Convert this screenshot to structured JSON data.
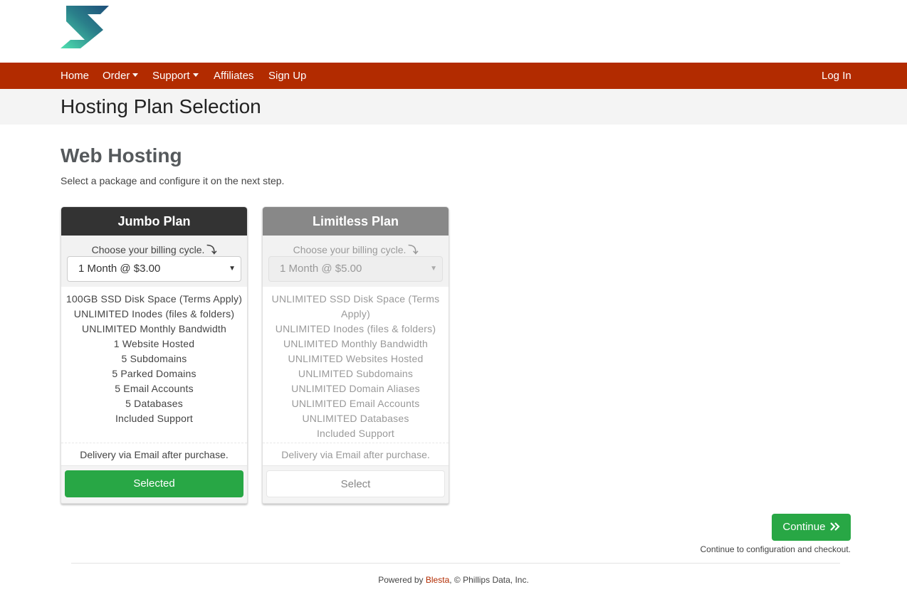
{
  "brand": {
    "accent": "#b22b00",
    "success": "#28a745",
    "logo_icon": "s-logo-icon"
  },
  "nav": {
    "left": [
      {
        "label": "Home",
        "dropdown": false
      },
      {
        "label": "Order",
        "dropdown": true
      },
      {
        "label": "Support",
        "dropdown": true
      },
      {
        "label": "Affiliates",
        "dropdown": false
      },
      {
        "label": "Sign Up",
        "dropdown": false
      }
    ],
    "login": "Log In"
  },
  "page_title": "Hosting Plan Selection",
  "section": {
    "title": "Web Hosting",
    "description": "Select a package and configure it on the next step."
  },
  "plans": [
    {
      "name": "Jumbo Plan",
      "cycle_label": "Choose your billing cycle.",
      "cycle_value": "1 Month @ $3.00",
      "features": [
        "100GB SSD Disk Space (Terms Apply)",
        "UNLIMITED Inodes (files & folders)",
        "UNLIMITED Monthly Bandwidth",
        "1 Website Hosted",
        "5 Subdomains",
        "5 Parked Domains",
        "5 Email Accounts",
        "5 Databases",
        "Included Support"
      ],
      "delivery": "Delivery via Email after purchase.",
      "button": "Selected",
      "selected": true,
      "header_color": "#333333"
    },
    {
      "name": "Limitless Plan",
      "cycle_label": "Choose your billing cycle.",
      "cycle_value": "1 Month @ $5.00",
      "features": [
        "UNLIMITED SSD Disk Space (Terms Apply)",
        "UNLIMITED Inodes (files & folders)",
        "UNLIMITED Monthly Bandwidth",
        "UNLIMITED Websites Hosted",
        "UNLIMITED Subdomains",
        "UNLIMITED Domain Aliases",
        "UNLIMITED Email Accounts",
        "UNLIMITED Databases",
        "Included Support"
      ],
      "delivery": "Delivery via Email after purchase.",
      "button": "Select",
      "selected": false,
      "header_color": "#888888"
    }
  ],
  "continue": {
    "label": "Continue",
    "icon": "double-chevron-right-icon",
    "note": "Continue to configuration and checkout."
  },
  "footer": {
    "prefix": "Powered by ",
    "link": "Blesta",
    "suffix": ", © Phillips Data, Inc."
  }
}
